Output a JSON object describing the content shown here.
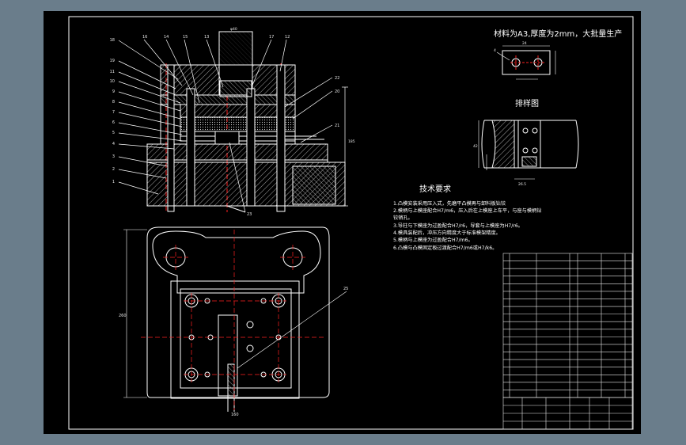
{
  "colors": {
    "background": "#6a7d8b",
    "sheet": "#000000",
    "line": "#ffffff",
    "centerline": "#ff2020",
    "section": "#d0d0d0",
    "dim": "#c0c0c0",
    "table": "#e8e8e8"
  },
  "header": {
    "material_note": "材料为A3,厚度为2mm，大批量生产",
    "layout_title": "排样图"
  },
  "tech": {
    "title": "技术要求",
    "lines": [
      "1.凸模安装采用压入式，先磨平凸模再与卸料板钻铰",
      "2.模柄与上模座配合H7/m6，压入后在上模座上车平，与座与模柄钻",
      "  铰销孔。",
      "3.导柱与下模座为过盈配合H7/r6，导套与上模座为H7/r6。",
      "4.模具装配后，冲压方向精度大于标准模架精度。",
      "5.模柄与上模座为过盈配合H7/m6。",
      "6.凸模与凸模固定板过渡配合H7/m6或H7/k6。"
    ]
  },
  "callouts": {
    "left": [
      "18",
      "19",
      "11",
      "10",
      "9",
      "8",
      "7",
      "6",
      "5",
      "4",
      "3",
      "2",
      "1"
    ],
    "top": [
      "16",
      "14",
      "15",
      "13",
      "17",
      "12"
    ],
    "right": [
      "22",
      "20",
      "21"
    ],
    "bottom": [
      "23"
    ],
    "plan": [
      "25"
    ]
  },
  "dims": {
    "top_center": "φ40",
    "right_height": "185",
    "plan_left": "260",
    "plan_bottom": "160",
    "part_width": "24",
    "part_hole": "4",
    "layout_width": "42",
    "layout_pitch": "26.5"
  },
  "bom": {
    "rows": 19
  }
}
